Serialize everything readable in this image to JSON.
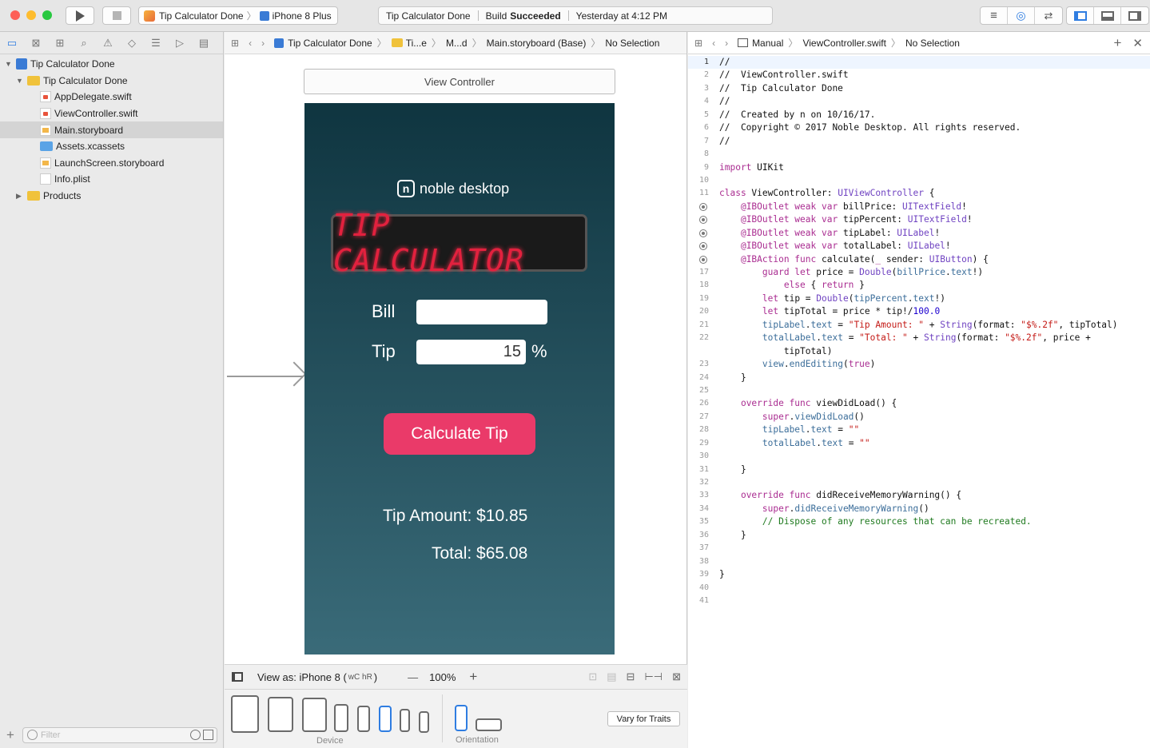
{
  "toolbar": {
    "scheme_name": "Tip Calculator Done",
    "device_name": "iPhone 8 Plus",
    "activity_project": "Tip Calculator Done",
    "activity_build_prefix": "Build",
    "activity_build_status": "Succeeded",
    "activity_time": "Yesterday at 4:12 PM",
    "colors": {
      "close": "#fd5f57",
      "minimize": "#febc2e",
      "zoom": "#28c840"
    }
  },
  "navigator": {
    "items": [
      {
        "label": "Tip Calculator Done",
        "kind": "project"
      },
      {
        "label": "Tip Calculator Done",
        "kind": "group"
      },
      {
        "label": "AppDelegate.swift",
        "kind": "swift"
      },
      {
        "label": "ViewController.swift",
        "kind": "swift"
      },
      {
        "label": "Main.storyboard",
        "kind": "storyboard",
        "selected": true
      },
      {
        "label": "Assets.xcassets",
        "kind": "assets"
      },
      {
        "label": "LaunchScreen.storyboard",
        "kind": "storyboard"
      },
      {
        "label": "Info.plist",
        "kind": "plist"
      },
      {
        "label": "Products",
        "kind": "group"
      }
    ],
    "filter_placeholder": "Filter"
  },
  "storyboard": {
    "jumpbar": [
      "Tip Calculator Done",
      "Ti...e",
      "M...d",
      "Main.storyboard (Base)",
      "No Selection"
    ],
    "scene_title": "View Controller",
    "logo_text": "noble desktop",
    "logo_mark": "n",
    "lcd_text": "TIP CALCULATOR",
    "bill_label": "Bill",
    "bill_value": "",
    "tip_label": "Tip",
    "tip_value": "15",
    "percent_label": "%",
    "button_label": "Calculate Tip",
    "tip_amount": "Tip Amount: $10.85",
    "total": "Total: $65.08",
    "view_as": "View as: iPhone 8 (",
    "view_as_traits": "wC hR",
    "view_as_close": ")",
    "zoom": "100%",
    "device_caption": "Device",
    "orientation_caption": "Orientation",
    "vary_button": "Vary for Traits",
    "colors": {
      "accent_button": "#ea3a69",
      "lcd_text": "#e2213e",
      "gradient_top": "#0f3540",
      "gradient_bottom": "#3a6b79"
    }
  },
  "editor": {
    "jumpbar": [
      "Manual",
      "ViewController.swift",
      "No Selection"
    ]
  }
}
